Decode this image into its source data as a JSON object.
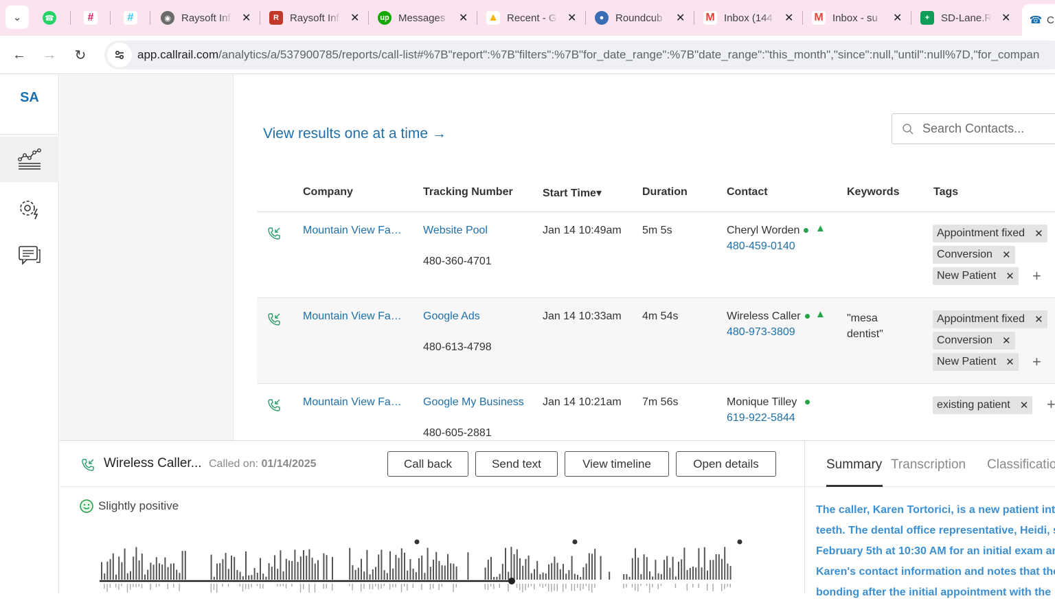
{
  "browser": {
    "tabs": [
      {
        "label": "",
        "icon": "whatsapp-icon",
        "color": "#25d366"
      },
      {
        "label": "",
        "icon": "slack-icon",
        "color": "#e01e5a"
      },
      {
        "label": "",
        "icon": "slack-icon",
        "color": "#e01e5a"
      },
      {
        "label": "Raysoft Inf",
        "icon": "globe-icon",
        "color": "#5f6368"
      },
      {
        "label": "Raysoft Inf",
        "icon": "raysoft-icon",
        "color": "#c0392b"
      },
      {
        "label": "Messages",
        "icon": "upwork-icon",
        "color": "#14a800"
      },
      {
        "label": "Recent - G",
        "icon": "google-drive-icon",
        "color": "#f4b400"
      },
      {
        "label": "Roundcub",
        "icon": "roundcube-icon",
        "color": "#3b6db5"
      },
      {
        "label": "Inbox (144",
        "icon": "gmail-icon",
        "color": "#ea4335"
      },
      {
        "label": "Inbox - su",
        "icon": "gmail-icon",
        "color": "#ea4335"
      },
      {
        "label": "SD-Lane.R",
        "icon": "sheets-icon",
        "color": "#0f9d58"
      },
      {
        "label": "C",
        "icon": "phone-icon",
        "color": "#1a6fb0"
      }
    ],
    "url_host": "app.callrail.com",
    "url_path": "/analytics/a/537900785/reports/call-list#%7B\"report\":%7B\"filters\":%7B\"for_date_range\":%7B\"date_range\":\"this_month\",\"since\":null,\"until\":null%7D,\"for_compan"
  },
  "nav": {
    "initials": "SA"
  },
  "main": {
    "view_link": "View results one at a time →",
    "search_placeholder": "Search Contacts...",
    "columns": {
      "company": "Company",
      "tracking": "Tracking Number",
      "start": "Start Time▾",
      "duration": "Duration",
      "contact": "Contact",
      "keywords": "Keywords",
      "tags": "Tags"
    },
    "rows": [
      {
        "company": "Mountain View Fa…",
        "source": "Website Pool",
        "tracking_number": "480-360-4701",
        "start": "Jan 14 10:49am",
        "duration": "5m 5s",
        "contact_name": "Cheryl Worden",
        "contact_phone": "480-459-0140",
        "keywords": "",
        "tags": [
          "Appointment fixed",
          "Conversion",
          "New Patient"
        ]
      },
      {
        "company": "Mountain View Fa…",
        "source": "Google Ads",
        "tracking_number": "480-613-4798",
        "start": "Jan 14 10:33am",
        "duration": "4m 54s",
        "contact_name": "Wireless Caller",
        "contact_phone": "480-973-3809",
        "keywords": "\"mesa dentist\"",
        "tags": [
          "Appointment fixed",
          "Conversion",
          "New Patient"
        ]
      },
      {
        "company": "Mountain View Fa…",
        "source": "Google My Business",
        "tracking_number": "480-605-2881",
        "start": "Jan 14 10:21am",
        "duration": "7m 56s",
        "contact_name": "Monique Tilley",
        "contact_phone": "619-922-5844",
        "keywords": "",
        "tags": [
          "existing patient"
        ]
      }
    ]
  },
  "panel": {
    "caller": "Wireless Caller...",
    "called_on_label": "Called on:",
    "called_on_date": "01/14/2025",
    "buttons": {
      "call_back": "Call back",
      "send_text": "Send text",
      "view_timeline": "View timeline",
      "open_details": "Open details"
    },
    "sentiment": "Slightly positive",
    "tabs": {
      "summary": "Summary",
      "transcription": "Transcription",
      "classification": "Classification"
    },
    "summary_lines": [
      "The caller, Karen Tortorici, is a new patient inte",
      "teeth. The dental office representative, Heidi, s",
      "February 5th at 10:30 AM for an initial exam an",
      "Karen's contact information and notes that the",
      "bonding after the initial appointment with the"
    ]
  },
  "colors": {
    "brand_blue": "#1f6fa8",
    "positive_green": "#27a34a",
    "summary_blue": "#3c8fd0",
    "tab_strip": "#fbe4ef"
  }
}
